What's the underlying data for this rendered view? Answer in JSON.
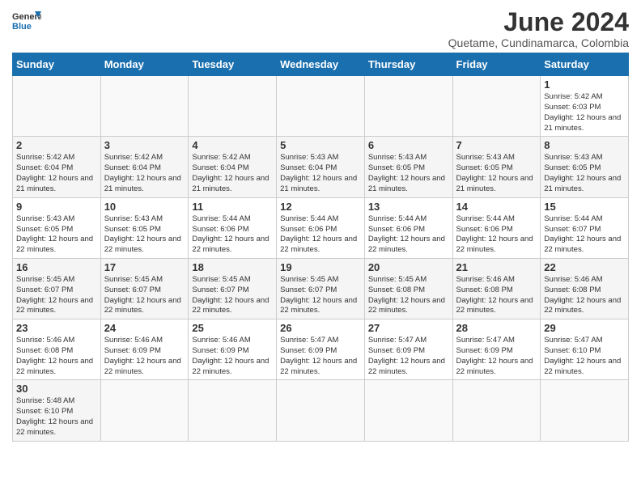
{
  "header": {
    "logo_general": "General",
    "logo_blue": "Blue",
    "month": "June 2024",
    "location": "Quetame, Cundinamarca, Colombia"
  },
  "days_of_week": [
    "Sunday",
    "Monday",
    "Tuesday",
    "Wednesday",
    "Thursday",
    "Friday",
    "Saturday"
  ],
  "weeks": [
    [
      null,
      null,
      null,
      null,
      null,
      null,
      {
        "day": "1",
        "sunrise": "Sunrise: 5:42 AM",
        "sunset": "Sunset: 6:03 PM",
        "daylight": "Daylight: 12 hours and 21 minutes."
      }
    ],
    [
      {
        "day": "2",
        "sunrise": "Sunrise: 5:42 AM",
        "sunset": "Sunset: 6:04 PM",
        "daylight": "Daylight: 12 hours and 21 minutes."
      },
      {
        "day": "3",
        "sunrise": "Sunrise: 5:42 AM",
        "sunset": "Sunset: 6:04 PM",
        "daylight": "Daylight: 12 hours and 21 minutes."
      },
      {
        "day": "4",
        "sunrise": "Sunrise: 5:42 AM",
        "sunset": "Sunset: 6:04 PM",
        "daylight": "Daylight: 12 hours and 21 minutes."
      },
      {
        "day": "5",
        "sunrise": "Sunrise: 5:43 AM",
        "sunset": "Sunset: 6:04 PM",
        "daylight": "Daylight: 12 hours and 21 minutes."
      },
      {
        "day": "6",
        "sunrise": "Sunrise: 5:43 AM",
        "sunset": "Sunset: 6:05 PM",
        "daylight": "Daylight: 12 hours and 21 minutes."
      },
      {
        "day": "7",
        "sunrise": "Sunrise: 5:43 AM",
        "sunset": "Sunset: 6:05 PM",
        "daylight": "Daylight: 12 hours and 21 minutes."
      },
      {
        "day": "8",
        "sunrise": "Sunrise: 5:43 AM",
        "sunset": "Sunset: 6:05 PM",
        "daylight": "Daylight: 12 hours and 21 minutes."
      }
    ],
    [
      {
        "day": "9",
        "sunrise": "Sunrise: 5:43 AM",
        "sunset": "Sunset: 6:05 PM",
        "daylight": "Daylight: 12 hours and 22 minutes."
      },
      {
        "day": "10",
        "sunrise": "Sunrise: 5:43 AM",
        "sunset": "Sunset: 6:05 PM",
        "daylight": "Daylight: 12 hours and 22 minutes."
      },
      {
        "day": "11",
        "sunrise": "Sunrise: 5:44 AM",
        "sunset": "Sunset: 6:06 PM",
        "daylight": "Daylight: 12 hours and 22 minutes."
      },
      {
        "day": "12",
        "sunrise": "Sunrise: 5:44 AM",
        "sunset": "Sunset: 6:06 PM",
        "daylight": "Daylight: 12 hours and 22 minutes."
      },
      {
        "day": "13",
        "sunrise": "Sunrise: 5:44 AM",
        "sunset": "Sunset: 6:06 PM",
        "daylight": "Daylight: 12 hours and 22 minutes."
      },
      {
        "day": "14",
        "sunrise": "Sunrise: 5:44 AM",
        "sunset": "Sunset: 6:06 PM",
        "daylight": "Daylight: 12 hours and 22 minutes."
      },
      {
        "day": "15",
        "sunrise": "Sunrise: 5:44 AM",
        "sunset": "Sunset: 6:07 PM",
        "daylight": "Daylight: 12 hours and 22 minutes."
      }
    ],
    [
      {
        "day": "16",
        "sunrise": "Sunrise: 5:45 AM",
        "sunset": "Sunset: 6:07 PM",
        "daylight": "Daylight: 12 hours and 22 minutes."
      },
      {
        "day": "17",
        "sunrise": "Sunrise: 5:45 AM",
        "sunset": "Sunset: 6:07 PM",
        "daylight": "Daylight: 12 hours and 22 minutes."
      },
      {
        "day": "18",
        "sunrise": "Sunrise: 5:45 AM",
        "sunset": "Sunset: 6:07 PM",
        "daylight": "Daylight: 12 hours and 22 minutes."
      },
      {
        "day": "19",
        "sunrise": "Sunrise: 5:45 AM",
        "sunset": "Sunset: 6:07 PM",
        "daylight": "Daylight: 12 hours and 22 minutes."
      },
      {
        "day": "20",
        "sunrise": "Sunrise: 5:45 AM",
        "sunset": "Sunset: 6:08 PM",
        "daylight": "Daylight: 12 hours and 22 minutes."
      },
      {
        "day": "21",
        "sunrise": "Sunrise: 5:46 AM",
        "sunset": "Sunset: 6:08 PM",
        "daylight": "Daylight: 12 hours and 22 minutes."
      },
      {
        "day": "22",
        "sunrise": "Sunrise: 5:46 AM",
        "sunset": "Sunset: 6:08 PM",
        "daylight": "Daylight: 12 hours and 22 minutes."
      }
    ],
    [
      {
        "day": "23",
        "sunrise": "Sunrise: 5:46 AM",
        "sunset": "Sunset: 6:08 PM",
        "daylight": "Daylight: 12 hours and 22 minutes."
      },
      {
        "day": "24",
        "sunrise": "Sunrise: 5:46 AM",
        "sunset": "Sunset: 6:09 PM",
        "daylight": "Daylight: 12 hours and 22 minutes."
      },
      {
        "day": "25",
        "sunrise": "Sunrise: 5:46 AM",
        "sunset": "Sunset: 6:09 PM",
        "daylight": "Daylight: 12 hours and 22 minutes."
      },
      {
        "day": "26",
        "sunrise": "Sunrise: 5:47 AM",
        "sunset": "Sunset: 6:09 PM",
        "daylight": "Daylight: 12 hours and 22 minutes."
      },
      {
        "day": "27",
        "sunrise": "Sunrise: 5:47 AM",
        "sunset": "Sunset: 6:09 PM",
        "daylight": "Daylight: 12 hours and 22 minutes."
      },
      {
        "day": "28",
        "sunrise": "Sunrise: 5:47 AM",
        "sunset": "Sunset: 6:09 PM",
        "daylight": "Daylight: 12 hours and 22 minutes."
      },
      {
        "day": "29",
        "sunrise": "Sunrise: 5:47 AM",
        "sunset": "Sunset: 6:10 PM",
        "daylight": "Daylight: 12 hours and 22 minutes."
      }
    ],
    [
      {
        "day": "30",
        "sunrise": "Sunrise: 5:48 AM",
        "sunset": "Sunset: 6:10 PM",
        "daylight": "Daylight: 12 hours and 22 minutes."
      },
      null,
      null,
      null,
      null,
      null,
      null
    ]
  ]
}
